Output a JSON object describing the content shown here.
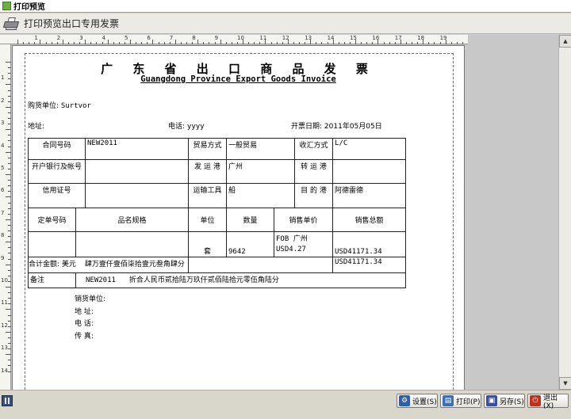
{
  "window": {
    "title": "打印预览"
  },
  "toolbar": {
    "title": "打印预览出口专用发票"
  },
  "ruler": {
    "top_labels": [
      "1",
      "2",
      "3",
      "4",
      "5",
      "6",
      "7",
      "8",
      "9",
      "10",
      "11",
      "12",
      "13",
      "14",
      "15",
      "16",
      "17",
      "18",
      "19",
      "20"
    ],
    "left_labels": [
      "1",
      "2",
      "3",
      "4",
      "5",
      "6",
      "7",
      "8",
      "9",
      "10",
      "11",
      "12",
      "13",
      "14"
    ]
  },
  "invoice": {
    "title": "广 东 省 出 口 商 品 发 票",
    "subtitle": "Guangdong Province Export Goods Invoice",
    "buyer_label": "购货单位:",
    "buyer_value": "Surtvor",
    "address_label": "地址:",
    "phone_label": "电话:",
    "phone_value": "yyyy",
    "date_label": "开票日期:",
    "date_value": "2011年05月05日",
    "contract_no_label": "合同号码",
    "contract_no_value": "NEW2011",
    "trade_mode_label": "贸易方式",
    "trade_mode_value": "一般贸易",
    "payment_label": "收汇方式",
    "payment_value": "L/C",
    "bank_label": "开户银行及帐号",
    "port_label": "发 运 港",
    "port_value": "广州",
    "transit_label": "转 运 港",
    "lc_label": "信用证号",
    "transport_label": "运输工具",
    "transport_value": "船",
    "dest_label": "目 的 港",
    "dest_value": "阿德雷德",
    "order_no_label": "定单号码",
    "spec_label": "品名规格",
    "unit_label": "单位",
    "qty_label": "数量",
    "unit_price_label": "销售单价",
    "total_label": "销售总额",
    "price_term": "FOB 广州",
    "row_unit": "套",
    "row_qty": "9642",
    "row_price": "USD4.27",
    "row_total": "USD41171.34",
    "sum_label": "合计金额:",
    "sum_currency": "美元",
    "sum_words": "肆万壹仟壹佰柒拾壹元叁角肆分",
    "sum_value": "USD41171.34",
    "remark_label": "备注",
    "remark_contract": "NEW2011",
    "remark_text": "折合人民币贰拾陆万玖仟贰佰陆拾元零伍角陆分",
    "seller_label": "销货单位:",
    "seller_addr_label": "地    址:",
    "seller_phone_label": "电    话:",
    "seller_fax_label": "传    真:"
  },
  "buttons": {
    "setup": "设置(S)",
    "print": "打印(P)",
    "save_as": "另存(S)",
    "exit": "退出(X)"
  },
  "colors": {
    "setup": "#2f5fa8",
    "print": "#3a6fb4",
    "save_as": "#3a4fa0",
    "exit": "#c0301c"
  }
}
